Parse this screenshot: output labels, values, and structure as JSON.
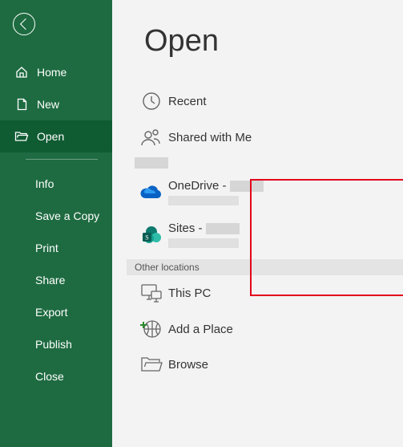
{
  "sidebar": {
    "nav": {
      "home": "Home",
      "new": "New",
      "open": "Open"
    },
    "sub": {
      "info": "Info",
      "save_copy": "Save a Copy",
      "print": "Print",
      "share": "Share",
      "export": "Export",
      "publish": "Publish",
      "close": "Close"
    }
  },
  "main": {
    "title": "Open",
    "recent": "Recent",
    "shared": "Shared with Me",
    "onedrive": "OneDrive - ",
    "sites": "Sites - ",
    "other_header": "Other locations",
    "thispc": "This PC",
    "addplace": "Add a Place",
    "browse": "Browse"
  }
}
